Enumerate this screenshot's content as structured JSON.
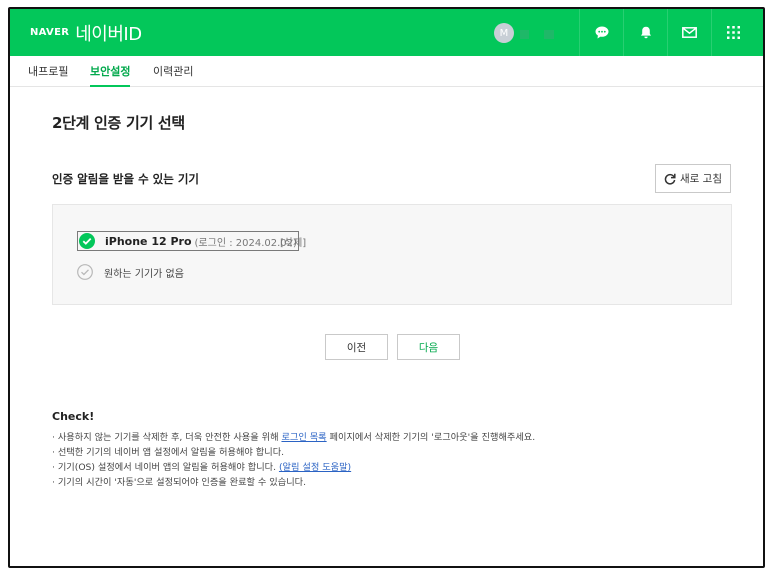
{
  "header": {
    "brand": "NAVER",
    "title": "네이버ID",
    "avatar_initial": "M",
    "colors": {
      "brand_green": "#03c75a",
      "text_green": "#03a94d",
      "link_blue": "#2b63c4"
    },
    "icons": [
      "chat-icon",
      "bell-icon",
      "mail-icon",
      "apps-grid-icon"
    ]
  },
  "tabs": [
    {
      "label": "내프로필",
      "active": false
    },
    {
      "label": "보안설정",
      "active": true
    },
    {
      "label": "이력관리",
      "active": false
    }
  ],
  "page": {
    "title": "2단계 인증 기기 선택",
    "section_title": "인증 알림을 받을 수 있는 기기",
    "refresh_label": "새로 고침"
  },
  "devices": {
    "primary": {
      "name": "iPhone 12 Pro",
      "login": "(로그인 : 2024.02.02)",
      "delete_label": "[삭제]",
      "selected": true
    },
    "none_label": "원하는 기기가 없음"
  },
  "buttons": {
    "prev": "이전",
    "next": "다음"
  },
  "check": {
    "title": "Check!",
    "note1_pre": "· 사용하지 않는 기기를 삭제한 후, 더욱 안전한 사용을 위해 ",
    "note1_link": "로그인 목록",
    "note1_post": " 페이지에서 삭제한 기기의 '로그아웃'을 진행해주세요.",
    "note2": "· 선택한 기기의 네이버 앱 설정에서 알림을 허용해야 합니다.",
    "note3_pre": "· 기기(OS) 설정에서 네이버 앱의 알림을 허용해야 합니다. ",
    "note3_link": "(알림 설정 도움말)",
    "note4": "· 기기의 시간이 '자동'으로 설정되어야 인증을 완료할 수 있습니다."
  }
}
